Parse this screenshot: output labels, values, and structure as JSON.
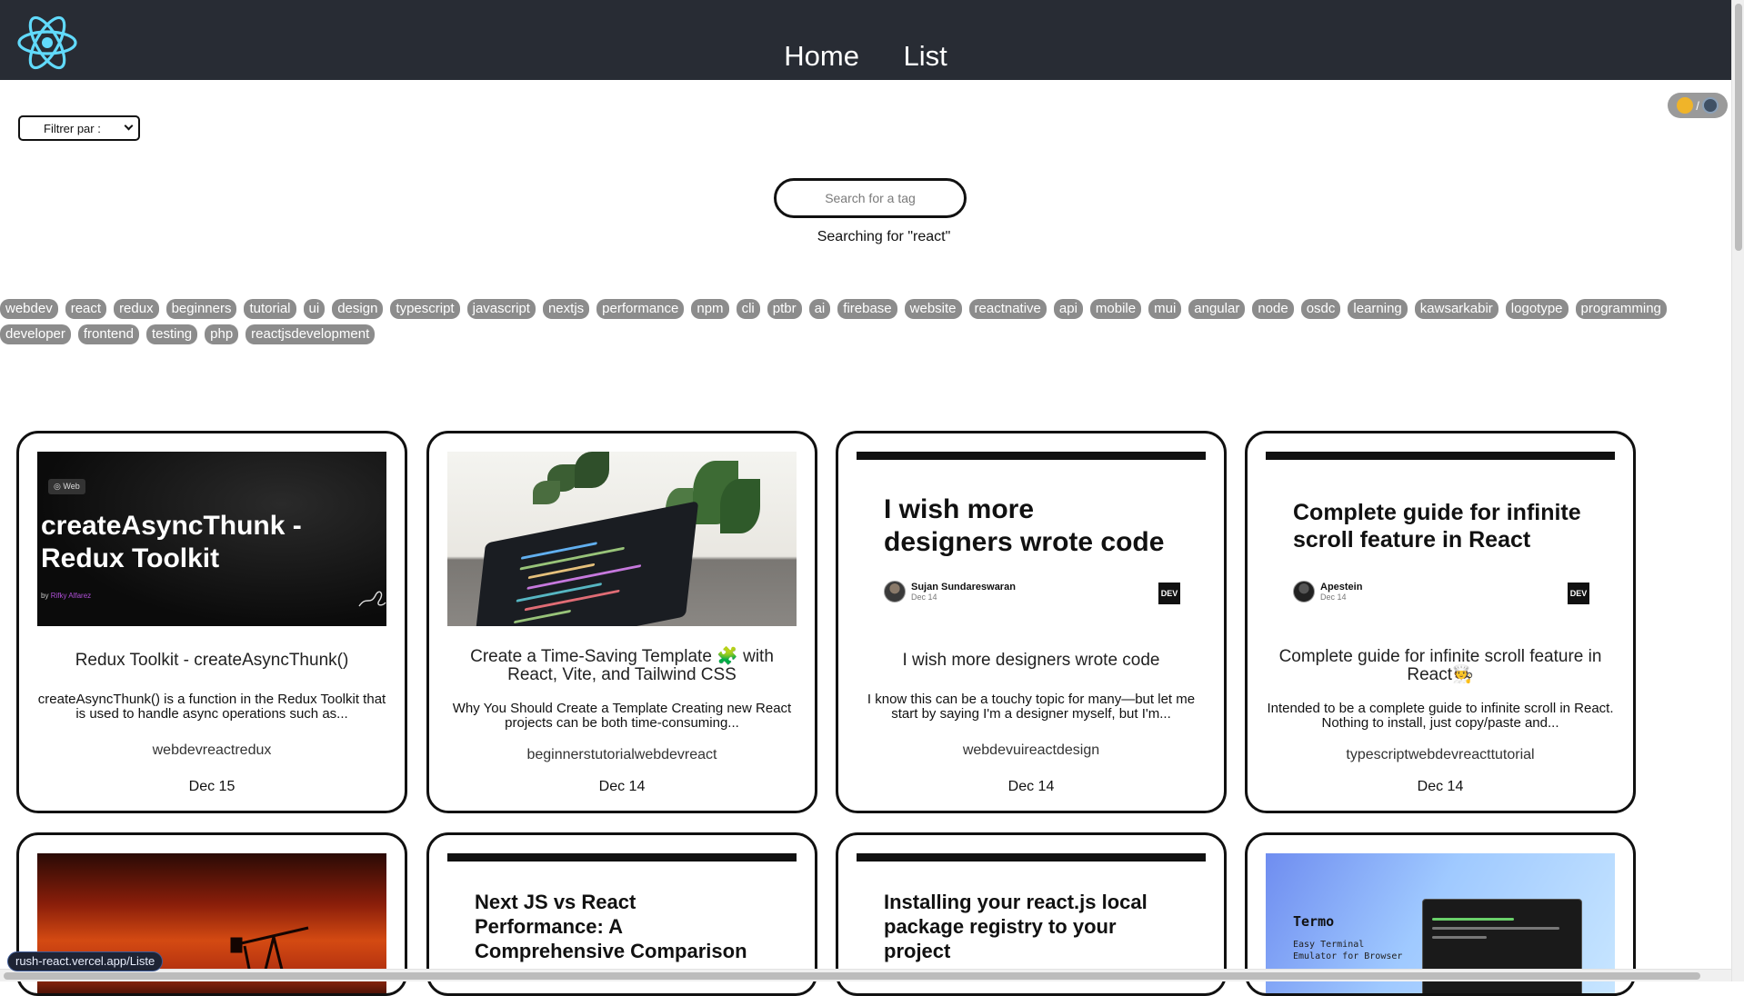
{
  "nav": {
    "links": [
      "Home",
      "List"
    ]
  },
  "theme_toggle": {
    "separator": "/"
  },
  "filter": {
    "selected": "Filtrer par :"
  },
  "search": {
    "placeholder": "Search for a tag",
    "status": "Searching for \"react\""
  },
  "tags": [
    "webdev",
    "react",
    "redux",
    "beginners",
    "tutorial",
    "ui",
    "design",
    "typescript",
    "javascript",
    "nextjs",
    "performance",
    "npm",
    "cli",
    "ptbr",
    "ai",
    "firebase",
    "website",
    "reactnative",
    "api",
    "mobile",
    "mui",
    "angular",
    "node",
    "osdc",
    "learning",
    "kawsarkabir",
    "logotype",
    "programming",
    "developer",
    "frontend",
    "testing",
    "php",
    "reactjsdevelopment"
  ],
  "cards": [
    {
      "cover": {
        "badge": "Web",
        "big": "createAsyncThunk - Redux Toolkit",
        "by": "by",
        "author": "Rifky Alfarez"
      },
      "title": "Redux Toolkit - createAsyncThunk()",
      "description": "createAsyncThunk() is a function in the Redux Toolkit that is used to handle async operations such as...",
      "tags": "webdevreactredux",
      "date": "Dec 15"
    },
    {
      "title": "Create a Time-Saving Template 🧩 with React, Vite, and Tailwind CSS",
      "description": "Why You Should Create a Template Creating new React projects can be both time-consuming...",
      "tags": "beginnerstutorialwebdevreact",
      "date": "Dec 14"
    },
    {
      "cover": {
        "title": "I wish more designers wrote code",
        "author": "Sujan Sundareswaran",
        "date": "Dec 14",
        "logo": "DEV"
      },
      "title": "I wish more designers wrote code",
      "description": "I know this can be a touchy topic for many—but let me start by saying I'm a designer myself, but I'm...",
      "tags": "webdevuireactdesign",
      "date": "Dec 14"
    },
    {
      "cover": {
        "title": "Complete guide for infinite scroll feature in React",
        "author": "Apestein",
        "date": "Dec 14",
        "logo": "DEV"
      },
      "title": "Complete guide for infinite scroll feature in React🧑‍🍳",
      "description": "Intended to be a complete guide to infinite scroll in React. Nothing to install, just copy/paste and...",
      "tags": "typescriptwebdevreacttutorial",
      "date": "Dec 14"
    },
    {},
    {
      "cover": {
        "title": "Next JS vs React Performance: A Comprehensive Comparison"
      }
    },
    {
      "cover": {
        "title": "Installing your react.js local package registry to your project"
      }
    },
    {
      "cover": {
        "title": "Termo",
        "subtitle_1": "Easy Terminal",
        "subtitle_2": "Emulator for Browser"
      }
    }
  ],
  "status_bar": {
    "url": "rush-react.vercel.app/Liste"
  }
}
